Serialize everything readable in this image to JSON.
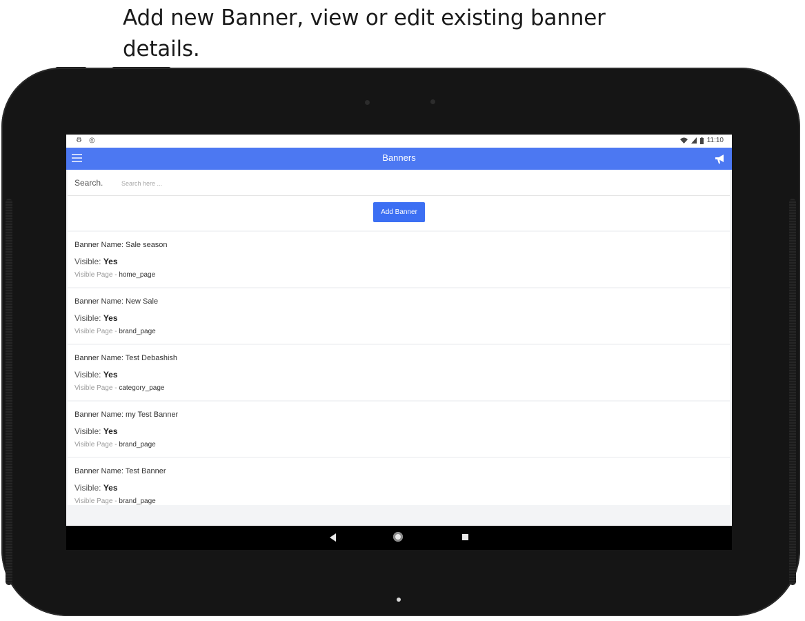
{
  "caption": "Add new Banner, view or edit existing banner details.",
  "status_bar": {
    "left_icons": [
      "settings-icon",
      "circle-icon"
    ],
    "time": "11:10",
    "right_icons": [
      "wifi-icon",
      "signal-icon",
      "battery-icon"
    ]
  },
  "app_bar": {
    "title": "Banners",
    "menu_icon": "hamburger-menu-icon",
    "action_icon": "megaphone-icon",
    "color": "#4c78f2"
  },
  "search": {
    "label": "Search.",
    "placeholder": "Search here ...",
    "value": ""
  },
  "add_button": {
    "label": "Add Banner",
    "color": "#3c6ff3"
  },
  "banners": [
    {
      "name_prefix": "Banner Name:",
      "name": "Sale season",
      "visible_label": "Visible:",
      "visible": "Yes",
      "page_label": "Visible Page",
      "page": "home_page"
    },
    {
      "name_prefix": "Banner Name:",
      "name": "New Sale",
      "visible_label": "Visible:",
      "visible": "Yes",
      "page_label": "Visible Page",
      "page": "brand_page"
    },
    {
      "name_prefix": "Banner Name:",
      "name": "Test Debashish",
      "visible_label": "Visible:",
      "visible": "Yes",
      "page_label": "Visible Page",
      "page": "category_page"
    },
    {
      "name_prefix": "Banner Name:",
      "name": "my Test Banner",
      "visible_label": "Visible:",
      "visible": "Yes",
      "page_label": "Visible Page",
      "page": "brand_page"
    },
    {
      "name_prefix": "Banner Name:",
      "name": "Test Banner",
      "visible_label": "Visible:",
      "visible": "Yes",
      "page_label": "Visible Page",
      "page": "brand_page"
    }
  ],
  "nav_bar": {
    "buttons": [
      "back-icon",
      "home-icon",
      "recents-icon"
    ]
  }
}
